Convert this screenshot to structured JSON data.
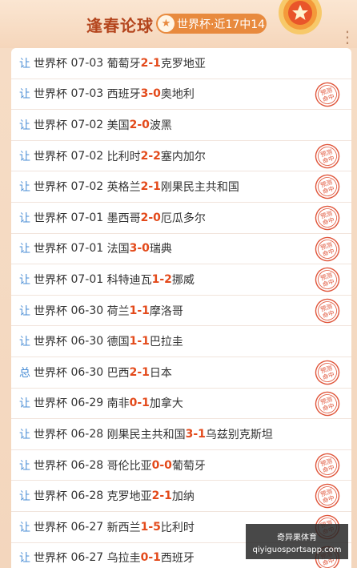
{
  "header": {
    "title": "逢春论球",
    "badge_star": "★",
    "badge_text": "世界杯·近17中14",
    "more_icon": "⋮"
  },
  "rows": [
    {
      "tag": "让",
      "league": "世界杯",
      "date": "07-03",
      "home": "葡萄牙",
      "hs": "2",
      "sep": " - ",
      "as": "1",
      "away": "克罗地亚",
      "hit": false
    },
    {
      "tag": "让",
      "league": "世界杯",
      "date": "07-03",
      "home": "西班牙",
      "hs": "3",
      "sep": " - ",
      "as": "0",
      "away": "奥地利",
      "hit": true
    },
    {
      "tag": "让",
      "league": "世界杯",
      "date": "07-02",
      "home": "美国",
      "hs": "2",
      "sep": " - ",
      "as": "0",
      "away": "波黑",
      "hit": false
    },
    {
      "tag": "让",
      "league": "世界杯",
      "date": "07-02",
      "home": "比利时",
      "hs": "2",
      "sep": " - ",
      "as": "2",
      "away": "塞内加尔",
      "hit": true
    },
    {
      "tag": "让",
      "league": "世界杯",
      "date": "07-02",
      "home": "英格兰",
      "hs": "2",
      "sep": " - ",
      "as": "1",
      "away": "刚果民主共和国",
      "hit": true
    },
    {
      "tag": "让",
      "league": "世界杯",
      "date": "07-01",
      "home": "墨西哥",
      "hs": "2",
      "sep": " - ",
      "as": "0",
      "away": "厄瓜多尔",
      "hit": true
    },
    {
      "tag": "让",
      "league": "世界杯",
      "date": "07-01",
      "home": "法国",
      "hs": "3",
      "sep": " - ",
      "as": "0",
      "away": "瑞典",
      "hit": true
    },
    {
      "tag": "让",
      "league": "世界杯",
      "date": "07-01",
      "home": "科特迪瓦",
      "hs": "1",
      "sep": " - ",
      "as": "2",
      "away": "挪威",
      "hit": true
    },
    {
      "tag": "让",
      "league": "世界杯",
      "date": "06-30",
      "home": "荷兰",
      "hs": "1",
      "sep": " - ",
      "as": "1",
      "away": "摩洛哥",
      "hit": true
    },
    {
      "tag": "让",
      "league": "世界杯",
      "date": "06-30",
      "home": "德国",
      "hs": "1",
      "sep": " - ",
      "as": "1",
      "away": "巴拉圭",
      "hit": false
    },
    {
      "tag": "总",
      "league": "世界杯",
      "date": "06-30",
      "home": "巴西",
      "hs": "2",
      "sep": " - ",
      "as": "1",
      "away": "日本",
      "hit": true
    },
    {
      "tag": "让",
      "league": "世界杯",
      "date": "06-29",
      "home": "南非",
      "hs": "0",
      "sep": " - ",
      "as": "1",
      "away": "加拿大",
      "hit": true
    },
    {
      "tag": "让",
      "league": "世界杯",
      "date": "06-28",
      "home": "刚果民主共和国",
      "hs": "3",
      "sep": " - ",
      "as": "1",
      "away": "乌兹别克斯坦",
      "hit": false
    },
    {
      "tag": "让",
      "league": "世界杯",
      "date": "06-28",
      "home": "哥伦比亚",
      "hs": "0",
      "sep": " - ",
      "as": "0",
      "away": "葡萄牙",
      "hit": true
    },
    {
      "tag": "让",
      "league": "世界杯",
      "date": "06-28",
      "home": "克罗地亚",
      "hs": "2",
      "sep": " - ",
      "as": "1",
      "away": "加纳",
      "hit": true
    },
    {
      "tag": "让",
      "league": "世界杯",
      "date": "06-27",
      "home": "新西兰",
      "hs": "1",
      "sep": " - ",
      "as": "5",
      "away": "比利时",
      "hit": true
    },
    {
      "tag": "让",
      "league": "世界杯",
      "date": "06-27",
      "home": "乌拉圭",
      "hs": "0",
      "sep": " - ",
      "as": "1",
      "away": "西班牙",
      "hit": true
    }
  ],
  "stamp": {
    "line1": "预测",
    "line2": "命中",
    "color": "#e0553a"
  },
  "watermark": {
    "line1": "奇异果体育",
    "line2": "qiyiguosportsapp.com"
  },
  "colors": {
    "accent": "#e34a1b",
    "tag": "#4a8ed6",
    "title": "#b4451d",
    "badge": "#e88a3e"
  }
}
